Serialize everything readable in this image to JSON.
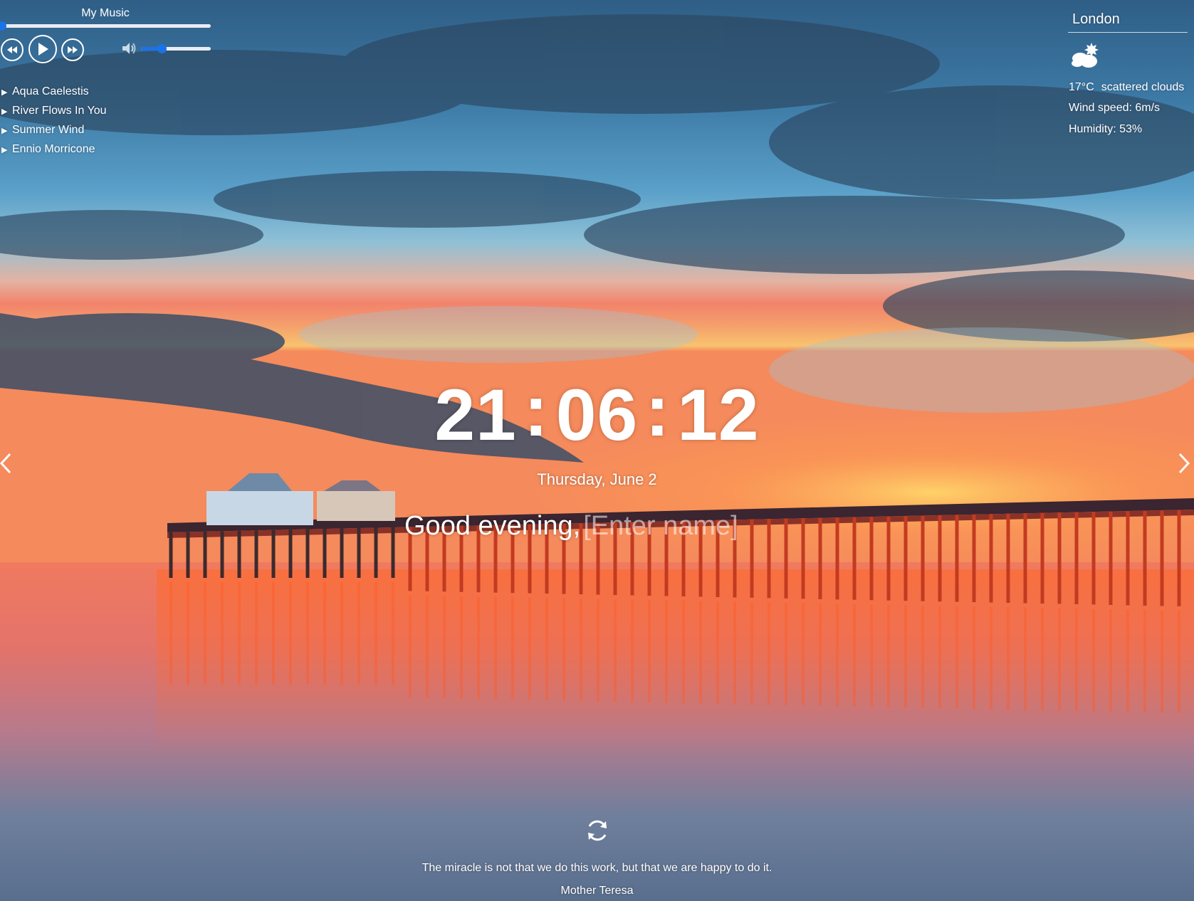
{
  "player": {
    "title": "My Music",
    "progress": 0.0,
    "volume": 0.3,
    "controls": [
      "rewind-icon",
      "play-icon",
      "fast-forward-icon",
      "volume-icon"
    ],
    "playlist": [
      {
        "label": "Aqua Caelestis"
      },
      {
        "label": "River Flows In You"
      },
      {
        "label": "Summer Wind"
      },
      {
        "label": "Ennio Morricone"
      }
    ]
  },
  "weather": {
    "city": "London",
    "icon": "scattered-clouds-icon",
    "temperature": "17°C",
    "description": "scattered clouds",
    "wind": "Wind speed: 6m/s",
    "humidity": "Humidity: 53%"
  },
  "clock": {
    "hours": "21",
    "minutes": "06",
    "seconds": "12",
    "separator": ":"
  },
  "date": "Thursday, June 2",
  "greeting": {
    "text": "Good evening,",
    "name_placeholder": "[Enter name]",
    "name_value": ""
  },
  "slider": {
    "prev_icon": "chevron-left-icon",
    "next_icon": "chevron-right-icon"
  },
  "quote": {
    "refresh_icon": "refresh-icon",
    "text": "The miracle is not that we do this work, but that we are happy to do it.",
    "author": "Mother Teresa"
  },
  "colors": {
    "accent": "#1a73e8",
    "text": "#ffffff"
  }
}
